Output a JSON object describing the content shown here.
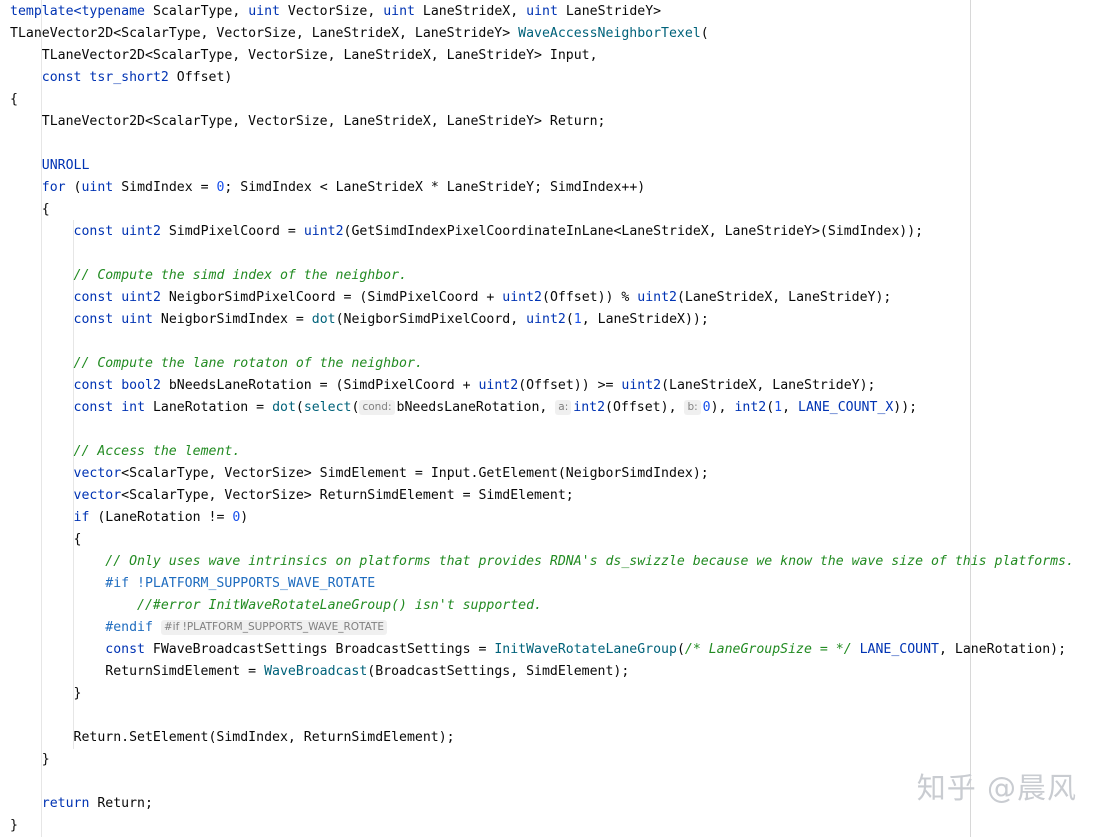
{
  "code_lines": [
    [
      {
        "t": "template<",
        "c": "kw"
      },
      {
        "t": "typename",
        "c": "kw"
      },
      {
        "t": " ScalarType, ",
        "c": ""
      },
      {
        "t": "uint",
        "c": "kw"
      },
      {
        "t": " VectorSize, ",
        "c": ""
      },
      {
        "t": "uint",
        "c": "kw"
      },
      {
        "t": " LaneStrideX, ",
        "c": ""
      },
      {
        "t": "uint",
        "c": "kw"
      },
      {
        "t": " LaneStrideY>",
        "c": ""
      }
    ],
    [
      {
        "t": "TLaneVector2D<ScalarType, VectorSize, LaneStrideX, LaneStrideY> ",
        "c": ""
      },
      {
        "t": "WaveAccessNeighborTexel",
        "c": "fn"
      },
      {
        "t": "(",
        "c": ""
      }
    ],
    [
      {
        "t": "    TLaneVector2D<ScalarType, VectorSize, LaneStrideX, LaneStrideY> Input,",
        "c": ""
      }
    ],
    [
      {
        "t": "    ",
        "c": ""
      },
      {
        "t": "const",
        "c": "kw"
      },
      {
        "t": " ",
        "c": ""
      },
      {
        "t": "tsr_short2",
        "c": "kw"
      },
      {
        "t": " Offset)",
        "c": ""
      }
    ],
    [
      {
        "t": "{",
        "c": ""
      }
    ],
    [
      {
        "t": "    TLaneVector2D<ScalarType, VectorSize, LaneStrideX, LaneStrideY> Return;",
        "c": ""
      }
    ],
    [],
    [
      {
        "t": "    ",
        "c": ""
      },
      {
        "t": "UNROLL",
        "c": "kw"
      }
    ],
    [
      {
        "t": "    ",
        "c": ""
      },
      {
        "t": "for",
        "c": "kw"
      },
      {
        "t": " (",
        "c": ""
      },
      {
        "t": "uint",
        "c": "kw"
      },
      {
        "t": " SimdIndex = ",
        "c": ""
      },
      {
        "t": "0",
        "c": "num"
      },
      {
        "t": "; SimdIndex < LaneStrideX * LaneStrideY; SimdIndex++)",
        "c": ""
      }
    ],
    [
      {
        "t": "    {",
        "c": ""
      }
    ],
    [
      {
        "t": "        ",
        "c": ""
      },
      {
        "t": "const",
        "c": "kw"
      },
      {
        "t": " ",
        "c": ""
      },
      {
        "t": "uint2",
        "c": "kw"
      },
      {
        "t": " SimdPixelCoord = ",
        "c": ""
      },
      {
        "t": "uint2",
        "c": "kw"
      },
      {
        "t": "(GetSimdIndexPixelCoordinateInLane<LaneStrideX, LaneStrideY>(SimdIndex));",
        "c": ""
      }
    ],
    [],
    [
      {
        "t": "        ",
        "c": ""
      },
      {
        "t": "// Compute the simd index of the neighbor.",
        "c": "cmt2"
      }
    ],
    [
      {
        "t": "        ",
        "c": ""
      },
      {
        "t": "const",
        "c": "kw"
      },
      {
        "t": " ",
        "c": ""
      },
      {
        "t": "uint2",
        "c": "kw"
      },
      {
        "t": " NeigborSimdPixelCoord = (SimdPixelCoord + ",
        "c": ""
      },
      {
        "t": "uint2",
        "c": "kw"
      },
      {
        "t": "(Offset)) % ",
        "c": ""
      },
      {
        "t": "uint2",
        "c": "kw"
      },
      {
        "t": "(LaneStrideX, LaneStrideY);",
        "c": ""
      }
    ],
    [
      {
        "t": "        ",
        "c": ""
      },
      {
        "t": "const",
        "c": "kw"
      },
      {
        "t": " ",
        "c": ""
      },
      {
        "t": "uint",
        "c": "kw"
      },
      {
        "t": " NeigborSimdIndex = ",
        "c": ""
      },
      {
        "t": "dot",
        "c": "fn"
      },
      {
        "t": "(NeigborSimdPixelCoord, ",
        "c": ""
      },
      {
        "t": "uint2",
        "c": "kw"
      },
      {
        "t": "(",
        "c": ""
      },
      {
        "t": "1",
        "c": "num"
      },
      {
        "t": ", LaneStrideX));",
        "c": ""
      }
    ],
    [],
    [
      {
        "t": "        ",
        "c": ""
      },
      {
        "t": "// Compute the lane rotaton of the neighbor.",
        "c": "cmt2"
      }
    ],
    [
      {
        "t": "        ",
        "c": ""
      },
      {
        "t": "const",
        "c": "kw"
      },
      {
        "t": " ",
        "c": ""
      },
      {
        "t": "bool2",
        "c": "kw"
      },
      {
        "t": " bNeedsLaneRotation = (SimdPixelCoord + ",
        "c": ""
      },
      {
        "t": "uint2",
        "c": "kw"
      },
      {
        "t": "(Offset)) >= ",
        "c": ""
      },
      {
        "t": "uint2",
        "c": "kw"
      },
      {
        "t": "(LaneStrideX, LaneStrideY);",
        "c": ""
      }
    ],
    [
      {
        "t": "        ",
        "c": ""
      },
      {
        "t": "const",
        "c": "kw"
      },
      {
        "t": " ",
        "c": ""
      },
      {
        "t": "int",
        "c": "kw"
      },
      {
        "t": " LaneRotation = ",
        "c": ""
      },
      {
        "t": "dot",
        "c": "fn"
      },
      {
        "t": "(",
        "c": ""
      },
      {
        "t": "select",
        "c": "fn"
      },
      {
        "t": "(",
        "c": ""
      },
      {
        "t": "cond:",
        "c": "hint"
      },
      {
        "t": "bNeedsLaneRotation, ",
        "c": ""
      },
      {
        "t": "a:",
        "c": "hint"
      },
      {
        "t": "int2",
        "c": "kw"
      },
      {
        "t": "(Offset), ",
        "c": ""
      },
      {
        "t": "b:",
        "c": "hint"
      },
      {
        "t": "0",
        "c": "num"
      },
      {
        "t": "), ",
        "c": ""
      },
      {
        "t": "int2",
        "c": "kw"
      },
      {
        "t": "(",
        "c": ""
      },
      {
        "t": "1",
        "c": "num"
      },
      {
        "t": ", ",
        "c": ""
      },
      {
        "t": "LANE_COUNT_X",
        "c": "kw"
      },
      {
        "t": "));",
        "c": ""
      }
    ],
    [],
    [
      {
        "t": "        ",
        "c": ""
      },
      {
        "t": "// Access the lement.",
        "c": "cmt2"
      }
    ],
    [
      {
        "t": "        ",
        "c": ""
      },
      {
        "t": "vector",
        "c": "kw"
      },
      {
        "t": "<ScalarType, VectorSize> SimdElement = Input.GetElement(NeigborSimdIndex);",
        "c": ""
      }
    ],
    [
      {
        "t": "        ",
        "c": ""
      },
      {
        "t": "vector",
        "c": "kw"
      },
      {
        "t": "<ScalarType, VectorSize> ReturnSimdElement = SimdElement;",
        "c": ""
      }
    ],
    [
      {
        "t": "        ",
        "c": ""
      },
      {
        "t": "if",
        "c": "kw"
      },
      {
        "t": " (LaneRotation != ",
        "c": ""
      },
      {
        "t": "0",
        "c": "num"
      },
      {
        "t": ")",
        "c": ""
      }
    ],
    [
      {
        "t": "        {",
        "c": ""
      }
    ],
    [
      {
        "t": "            ",
        "c": ""
      },
      {
        "t": "// Only uses wave intrinsics on platforms that provides RDNA's ds_swizzle because we know the wave size of this platforms.",
        "c": "cmt2"
      }
    ],
    [
      {
        "t": "            ",
        "c": ""
      },
      {
        "t": "#if !PLATFORM_SUPPORTS_WAVE_ROTATE",
        "c": "pp"
      }
    ],
    [
      {
        "t": "                ",
        "c": ""
      },
      {
        "t": "//#error InitWaveRotateLaneGroup() isn't supported.",
        "c": "cmt2"
      }
    ],
    [
      {
        "t": "            ",
        "c": ""
      },
      {
        "t": "#endif",
        "c": "pp"
      },
      {
        "t": " ",
        "c": ""
      },
      {
        "t": "#if !PLATFORM_SUPPORTS_WAVE_ROTATE",
        "c": "hint"
      }
    ],
    [
      {
        "t": "            ",
        "c": ""
      },
      {
        "t": "const",
        "c": "kw"
      },
      {
        "t": " FWaveBroadcastSettings BroadcastSettings = ",
        "c": ""
      },
      {
        "t": "InitWaveRotateLaneGroup",
        "c": "fn"
      },
      {
        "t": "(",
        "c": ""
      },
      {
        "t": "/* LaneGroupSize = */",
        "c": "cmt2"
      },
      {
        "t": " ",
        "c": ""
      },
      {
        "t": "LANE_COUNT",
        "c": "kw"
      },
      {
        "t": ", LaneRotation);",
        "c": ""
      }
    ],
    [
      {
        "t": "            ReturnSimdElement = ",
        "c": ""
      },
      {
        "t": "WaveBroadcast",
        "c": "fn"
      },
      {
        "t": "(BroadcastSettings, SimdElement);",
        "c": ""
      }
    ],
    [
      {
        "t": "        }",
        "c": ""
      }
    ],
    [],
    [
      {
        "t": "        Return.SetElement(SimdIndex, ReturnSimdElement);",
        "c": ""
      }
    ],
    [
      {
        "t": "    }",
        "c": ""
      }
    ],
    [],
    [
      {
        "t": "    ",
        "c": ""
      },
      {
        "t": "return",
        "c": "kw"
      },
      {
        "t": " Return;",
        "c": ""
      }
    ],
    [
      {
        "t": "}",
        "c": ""
      }
    ]
  ],
  "watermark": "知乎 @晨风"
}
